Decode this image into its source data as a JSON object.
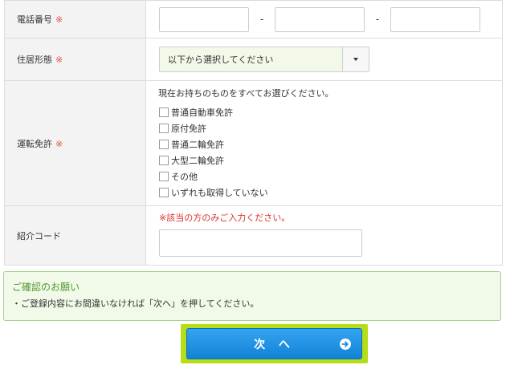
{
  "form": {
    "phone": {
      "label": "電話番号",
      "required_mark": "※",
      "separator": "-"
    },
    "housing": {
      "label": "住居形態",
      "required_mark": "※",
      "selected": "以下から選択してください"
    },
    "license": {
      "label": "運転免許",
      "required_mark": "※",
      "intro": "現在お持ちのものをすべてお選びください。",
      "options": [
        "普通自動車免許",
        "原付免許",
        "普通二輪免許",
        "大型二輪免許",
        "その他",
        "いずれも取得していない"
      ]
    },
    "referral": {
      "label": "紹介コード",
      "note": "※該当の方のみご入力ください。"
    }
  },
  "notice": {
    "title": "ご確認のお願い",
    "text": "・ご登録内容にお間違いなければ「次へ」を押してください。"
  },
  "next_button": {
    "label": "次 へ",
    "icon": "arrow-right-circle-icon"
  },
  "colors": {
    "required": "#e94e3c",
    "notice_title": "#4f9a2f",
    "button": "#1b8ee3",
    "highlight": "#b5de18"
  }
}
